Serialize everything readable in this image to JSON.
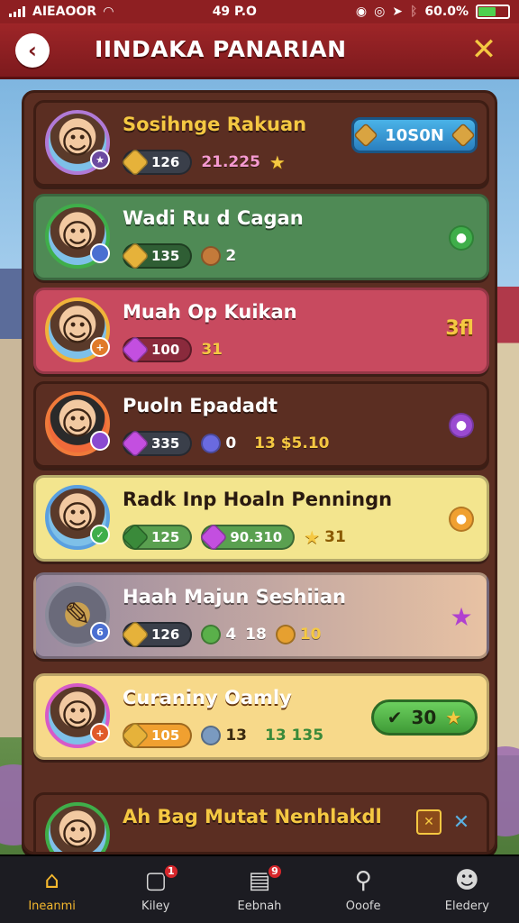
{
  "status_bar": {
    "carrier": "AIEAOOR",
    "time": "49 P.O",
    "battery": "60.0%",
    "battery_level": 0.6
  },
  "header": {
    "title": "IINDAKA PANARIAN",
    "back_icon": "chevron-left-icon",
    "close_icon": "close-icon"
  },
  "colors": {
    "header_red": "#8e1f22",
    "panel_brown": "#5b2e22",
    "accent_gold": "#f5c842",
    "nav_active": "#f5b82e"
  },
  "rows": [
    {
      "name": "Sosihnge Rakuan",
      "card_color": "#5b2e22",
      "name_color": "#f5c842",
      "stat1": "126",
      "stat2": "21.225",
      "cost": "10S0N"
    },
    {
      "name": "Wadi Ru d Cagan",
      "card_color": "#4f8a55",
      "stat1": "135",
      "stat2": "2"
    },
    {
      "name": "Muah Op Kuikan",
      "card_color": "#c84a5f",
      "stat1": "100",
      "stat2": "31",
      "side_value": "3fl"
    },
    {
      "name": "Puoln Epadadt",
      "card_color": "#5b2e22",
      "stat1": "335",
      "stat2": "0",
      "stat3": "13 $5.10"
    },
    {
      "name": "Radk Inp Hoaln Penningn",
      "card_color": "#f3e58e",
      "stat1": "125",
      "stat2": "90.310",
      "stat3": "31"
    },
    {
      "name": "Haah Majun Seshiian",
      "card_color": "#e8c2a3",
      "stat1": "126",
      "stat2": "4",
      "stat3": "18",
      "stat4": "10"
    },
    {
      "name": "Curaniny Oamly",
      "card_color": "#f7d98a",
      "stat1": "105",
      "stat2": "13",
      "stat3": "13 135",
      "buy": "30"
    },
    {
      "name": "Ah Bag Mutat Nenhlakdl",
      "card_color": "#5b2e22",
      "stat1": "",
      "stat2": ""
    }
  ],
  "bottom_nav": [
    {
      "label": "Ineanmi",
      "icon": "home-icon",
      "active": true
    },
    {
      "label": "Kiley",
      "icon": "chat-icon",
      "badge": "1"
    },
    {
      "label": "Eebnah",
      "icon": "list-icon",
      "badge": "9"
    },
    {
      "label": "Ooofe",
      "icon": "search-icon"
    },
    {
      "label": "Eledery",
      "icon": "profile-icon"
    }
  ]
}
